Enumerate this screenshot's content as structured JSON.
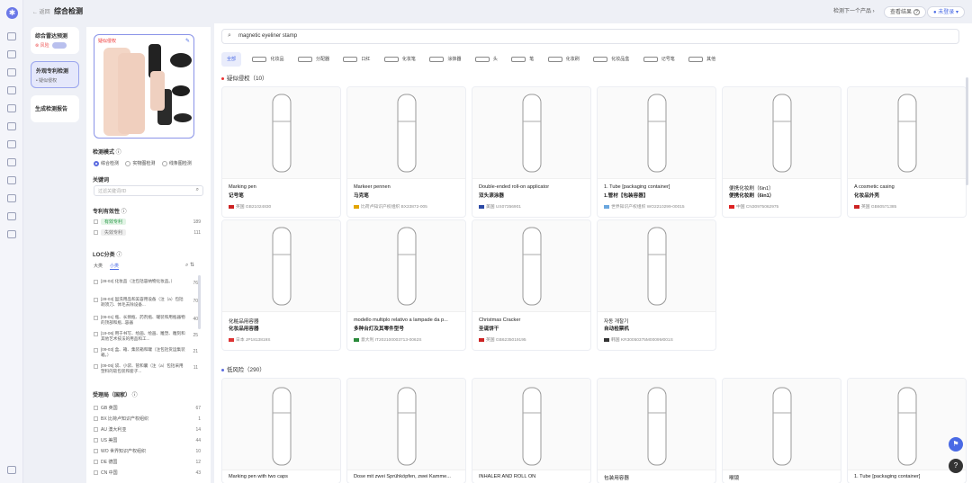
{
  "header": {
    "back": "← 返回",
    "title": "综合检测",
    "next": "检测下一个产品 ›",
    "export": "查看结果",
    "user": "未登录"
  },
  "nav": [
    {
      "title": "综合雷达预测",
      "sub": "⊗ 风险"
    },
    {
      "title": "外观专利检测",
      "sub": "• 疑似侵权"
    },
    {
      "title": "生成检测报告",
      "sub": ""
    }
  ],
  "filters": {
    "thumb_tag": "疑似侵权",
    "mode_label": "检测模式",
    "modes": [
      "综合检测",
      "实物图检测",
      "线条图检测"
    ],
    "kw_label": "关键词",
    "kw_placeholder": "过滤关键词/ID",
    "validity_label": "专利有效性",
    "validity": [
      {
        "label": "有效专利",
        "count": "189"
      },
      {
        "label": "失效专利",
        "count": "111"
      }
    ],
    "loc_label": "LOC分类",
    "loc_tabs": [
      "大类",
      "小类"
    ],
    "loc": [
      {
        "t": "[28-02] 化妆品（注包括容纳物化妆品。）",
        "c": "76"
      },
      {
        "t": "[28-03] 盥洗用品和美容用设备（注（a）包括剃须刀、体毛去除设备...",
        "c": "70"
      },
      {
        "t": "[09-01] 瓶、长颈瓶、药剂瓶、罐装和用瓶器物的顶部和瓶...容器",
        "c": "40"
      },
      {
        "t": "[19-06] 用于书写、绘画、绘画、雕塑、雕刻和其他艺术技法的用品和工...",
        "c": "25"
      },
      {
        "t": "[09-03] 盒、箱、集装箱和罐（注包括货运集装箱。）",
        "c": "21"
      },
      {
        "t": "[09-05] 袋、小袋、管和囊（注（a）包括采用塑料的软包装和套子...",
        "c": "11"
      }
    ],
    "country_label": "受理局（国家）",
    "countries": [
      {
        "f": "GB 英国",
        "c": "67"
      },
      {
        "f": "BX 比荷卢知识产权组织",
        "c": "1"
      },
      {
        "f": "AU 澳大利亚",
        "c": "14"
      },
      {
        "f": "US 美国",
        "c": "44"
      },
      {
        "f": "WO 世界知识产权组织",
        "c": "10"
      },
      {
        "f": "DE 德国",
        "c": "12"
      },
      {
        "f": "CN 中国",
        "c": "43"
      }
    ]
  },
  "search": "magnetic eyeliner stamp",
  "categories": [
    "全部",
    "化妆品",
    "分配器",
    "口红",
    "化妆笔",
    "涂抹器",
    "头",
    "笔",
    "化妆刷",
    "化妆品盒",
    "记号笔",
    "其他"
  ],
  "sections": [
    {
      "label": "疑似侵权（10）"
    },
    {
      "label": "低风险（290）"
    }
  ],
  "cards": [
    {
      "t1": "Marking pen",
      "t2": "记号笔",
      "m": "英国  GB21024830"
    },
    {
      "t1": "Markeer pennen",
      "t2": "马克笔",
      "m": "比荷卢知识产权组织  BX33872-005"
    },
    {
      "t1": "Double-ended roll-on applicator",
      "t2": "双头滚涂器",
      "m": "美国  US07356901"
    },
    {
      "t1": "1. Tube [packaging container]",
      "t2": "1.管材【包装容器】",
      "m": "世界知识产权组织  WO2210299-00015"
    },
    {
      "t1": "便携化妆刷（6in1）",
      "t2": "便携化妆刷（6in1）",
      "m": "中国  CN30975062975"
    },
    {
      "t1": "A cosmetic casing",
      "t2": "化妆品外壳",
      "m": "英国  GB60571385"
    },
    {
      "t1": "化粧品用容器",
      "t2": "化妆品用容器",
      "m": "日本  JP1813819S"
    },
    {
      "t1": "modello multiplo relativo a lampade da p...",
      "t2": "多种台灯及其零件型号",
      "m": "意大利  IT202100003713-0062S"
    },
    {
      "t1": "Christmas Cracker",
      "t2": "圣诞饼干",
      "m": "英国  GB6235019195"
    },
    {
      "t1": "자동 개찰기",
      "t2": "自动检票机",
      "m": "韩国  KR30050375M0009M001S"
    },
    {
      "t1": "Marking pen with two caps",
      "t2": "",
      "m": ""
    },
    {
      "t1": "Dose mit zwei Sprühköpfen, zwei Kamme...",
      "t2": "",
      "m": ""
    },
    {
      "t1": "INHALER AND ROLL ON",
      "t2": "",
      "m": ""
    },
    {
      "t1": "包装用容器",
      "t2": "",
      "m": ""
    },
    {
      "t1": "喉镜",
      "t2": "",
      "m": ""
    },
    {
      "t1": "1. Tube [packaging container]",
      "t2": "",
      "m": ""
    }
  ]
}
